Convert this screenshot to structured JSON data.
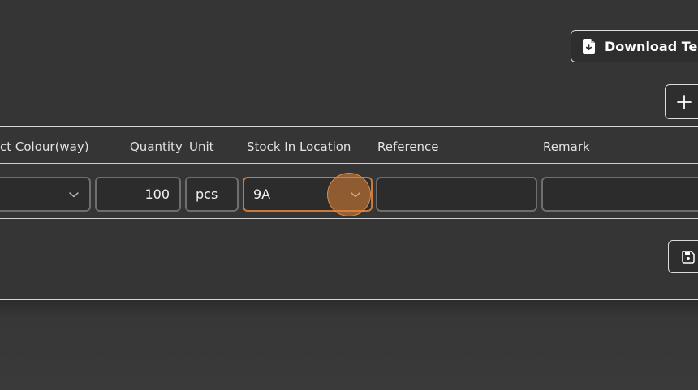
{
  "toolbar": {
    "download_label": "Download Tem",
    "download_icon": "file-download-icon",
    "add_icon": "plus-icon"
  },
  "table": {
    "headers": {
      "colour": "ct Colour(way)",
      "quantity": "Quantity",
      "unit": "Unit",
      "location": "Stock In Location",
      "reference": "Reference",
      "remark": "Remark"
    },
    "row": {
      "colour": "",
      "quantity": "100",
      "unit": "pcs",
      "location": "9A",
      "reference": "",
      "remark": ""
    }
  },
  "actions": {
    "save_icon": "save-icon"
  },
  "colors": {
    "background": "#353535",
    "focus_accent": "#c97b3c",
    "field_border": "#6e6e6e"
  }
}
